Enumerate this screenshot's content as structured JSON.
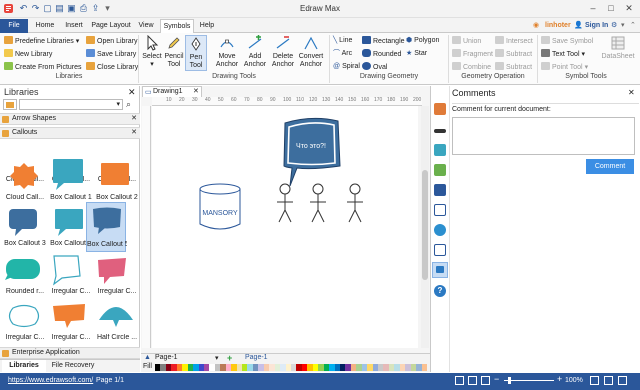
{
  "title_bar": {
    "app_title": "Edraw Max"
  },
  "tabs": [
    "File",
    "Home",
    "Insert",
    "Page Layout",
    "View",
    "Symbols",
    "Help"
  ],
  "active_tab": "Symbols",
  "account": {
    "user": "linhoter",
    "sign_in": "Sign In"
  },
  "ribbon": {
    "libraries": {
      "predefine": "Predefine Libraries",
      "open": "Open Library",
      "new": "New Library",
      "save": "Save Library",
      "create": "Create From Pictures",
      "close": "Close Library",
      "group": "Libraries"
    },
    "drawing_tools": {
      "select": "Select",
      "pencil": "Pencil Tool",
      "pen": "Pen Tool",
      "move_anchor": "Move Anchor",
      "add_anchor": "Add Anchor",
      "delete_anchor": "Delete Anchor",
      "convert_anchor": "Convert Anchor",
      "group": "Drawing Tools"
    },
    "drawing_geometry": {
      "line": "Line",
      "arc": "Arc",
      "spiral": "Spiral",
      "rectangle": "Rectangle",
      "rounded": "Rounded",
      "oval": "Oval",
      "polygon": "Polygon",
      "star": "Star",
      "group": "Drawing Geometry"
    },
    "geometry_operation": {
      "union": "Union",
      "intersect": "Intersect",
      "fragment": "Fragment",
      "subtract1": "Subtract",
      "combine": "Combine",
      "subtract2": "Subtract",
      "group": "Geometry Operation"
    },
    "symbol_tools": {
      "save_symbol": "Save Symbol",
      "text_tool": "Text Tool",
      "point_tool": "Point Tool",
      "datasheet": "DataSheet",
      "group": "Symbol Tools"
    }
  },
  "libraries_panel": {
    "title": "Libraries",
    "categories": [
      "Arrow Shapes",
      "Callouts"
    ],
    "shapes": [
      {
        "label": "Cloud Call...",
        "color": "#3aa6bf"
      },
      {
        "label": "Cloud Call...",
        "color": "#3aa6bf"
      },
      {
        "label": "Cloud Call...",
        "color": "#ffffff"
      },
      {
        "label": "Cloud Call...",
        "color": "#f07f33"
      },
      {
        "label": "Box Callout 1",
        "color": "#3aa6bf"
      },
      {
        "label": "Box Callout 2",
        "color": "#f07f33"
      },
      {
        "label": "Box Callout 3",
        "color": "#3d6e9e"
      },
      {
        "label": "Box Callout 4",
        "color": "#3aa6bf"
      },
      {
        "label": "Box Callout 5",
        "color": "#3d6e9e"
      },
      {
        "label": "Rounded r...",
        "color": "#22b5a8"
      },
      {
        "label": "Irregular C...",
        "color": "#ffffff"
      },
      {
        "label": "Irregular C...",
        "color": "#e0607e"
      },
      {
        "label": "Irregular C...",
        "color": "#ffffff"
      },
      {
        "label": "Irregular C...",
        "color": "#f07f33"
      },
      {
        "label": "Half Circle ...",
        "color": "#3aa6bf"
      }
    ],
    "enterprise": "Enterprise Application",
    "bottom_tabs": [
      "Libraries",
      "File Recovery"
    ]
  },
  "document": {
    "tab": "Drawing1",
    "ruler_marks": [
      "10",
      "20",
      "30",
      "40",
      "50",
      "60",
      "70",
      "80",
      "90",
      "100",
      "110",
      "120",
      "130",
      "140",
      "150",
      "160",
      "170",
      "180",
      "190",
      "200"
    ],
    "callout_text": "Что это?!",
    "cylinder_text": "MANSORY",
    "page_selector": "Page-1",
    "page_tab": "Page-1",
    "fill_label": "Fill"
  },
  "comments": {
    "title": "Comments",
    "label": "Comment for current document:",
    "button": "Comment"
  },
  "status": {
    "url": "https://www.edrawsoft.com/",
    "page": "Page 1/1",
    "zoom": "100%"
  },
  "palette": [
    "#000000",
    "#7f7f7f",
    "#880015",
    "#ed1c24",
    "#ff7f27",
    "#fff200",
    "#22b14c",
    "#00a2e8",
    "#3f48cc",
    "#a349a4",
    "#ffffff",
    "#c3c3c3",
    "#b97a57",
    "#ffaec9",
    "#ffc90e",
    "#efe4b0",
    "#b5e61d",
    "#99d9ea",
    "#7092be",
    "#c8bfe7",
    "#f8cbad",
    "#fbe5d6",
    "#e2f0d9",
    "#deebf7",
    "#fff2cc",
    "#d9d9d9",
    "#c00000",
    "#ff0000",
    "#ffc000",
    "#ffff00",
    "#92d050",
    "#00b050",
    "#00b0f0",
    "#0070c0",
    "#002060",
    "#7030a0",
    "#f4b183",
    "#a9d18e",
    "#9dc3e6",
    "#ffd966",
    "#8faadc",
    "#c9c9c9",
    "#e6b9b8",
    "#d7e4bd",
    "#b7dee8",
    "#fcd5b5",
    "#ccc0da",
    "#c4d79b",
    "#95b3d7",
    "#fac090"
  ]
}
